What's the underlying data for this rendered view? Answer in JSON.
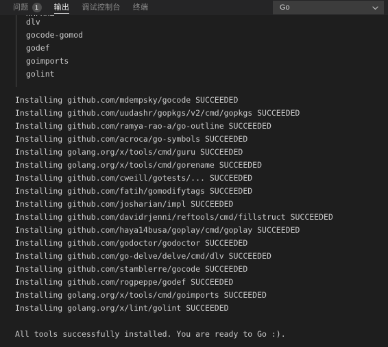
{
  "panel": {
    "tabs": [
      {
        "label": "问题",
        "badge": "1",
        "active": false,
        "name": "tab-problems"
      },
      {
        "label": "输出",
        "badge": null,
        "active": true,
        "name": "tab-output"
      },
      {
        "label": "调试控制台",
        "badge": null,
        "active": false,
        "name": "tab-debug-console"
      },
      {
        "label": "终端",
        "badge": null,
        "active": false,
        "name": "tab-terminal"
      }
    ],
    "channel_selector": {
      "value": "Go",
      "icon": "chevron-down-icon"
    }
  },
  "output": {
    "lines": [
      {
        "text": "gocode",
        "style": "clipped-top",
        "indented": true
      },
      {
        "text": "dlv",
        "indented": true
      },
      {
        "text": "gocode-gomod",
        "indented": true
      },
      {
        "text": "godef",
        "indented": true
      },
      {
        "text": "goimports",
        "indented": true
      },
      {
        "text": "golint",
        "indented": true
      },
      {
        "text": "",
        "blank": true
      },
      {
        "text": "Installing github.com/mdempsky/gocode SUCCEEDED"
      },
      {
        "text": "Installing github.com/uudashr/gopkgs/v2/cmd/gopkgs SUCCEEDED"
      },
      {
        "text": "Installing github.com/ramya-rao-a/go-outline SUCCEEDED"
      },
      {
        "text": "Installing github.com/acroca/go-symbols SUCCEEDED"
      },
      {
        "text": "Installing golang.org/x/tools/cmd/guru SUCCEEDED"
      },
      {
        "text": "Installing golang.org/x/tools/cmd/gorename SUCCEEDED"
      },
      {
        "text": "Installing github.com/cweill/gotests/... SUCCEEDED"
      },
      {
        "text": "Installing github.com/fatih/gomodifytags SUCCEEDED"
      },
      {
        "text": "Installing github.com/josharian/impl SUCCEEDED"
      },
      {
        "text": "Installing github.com/davidrjenni/reftools/cmd/fillstruct SUCCEEDED"
      },
      {
        "text": "Installing github.com/haya14busa/goplay/cmd/goplay SUCCEEDED"
      },
      {
        "text": "Installing github.com/godoctor/godoctor SUCCEEDED"
      },
      {
        "text": "Installing github.com/go-delve/delve/cmd/dlv SUCCEEDED"
      },
      {
        "text": "Installing github.com/stamblerre/gocode SUCCEEDED"
      },
      {
        "text": "Installing github.com/rogpeppe/godef SUCCEEDED"
      },
      {
        "text": "Installing golang.org/x/tools/cmd/goimports SUCCEEDED"
      },
      {
        "text": "Installing golang.org/x/lint/golint SUCCEEDED"
      },
      {
        "text": "",
        "blank": true
      },
      {
        "text": "All tools successfully installed. You are ready to Go :)."
      }
    ]
  }
}
